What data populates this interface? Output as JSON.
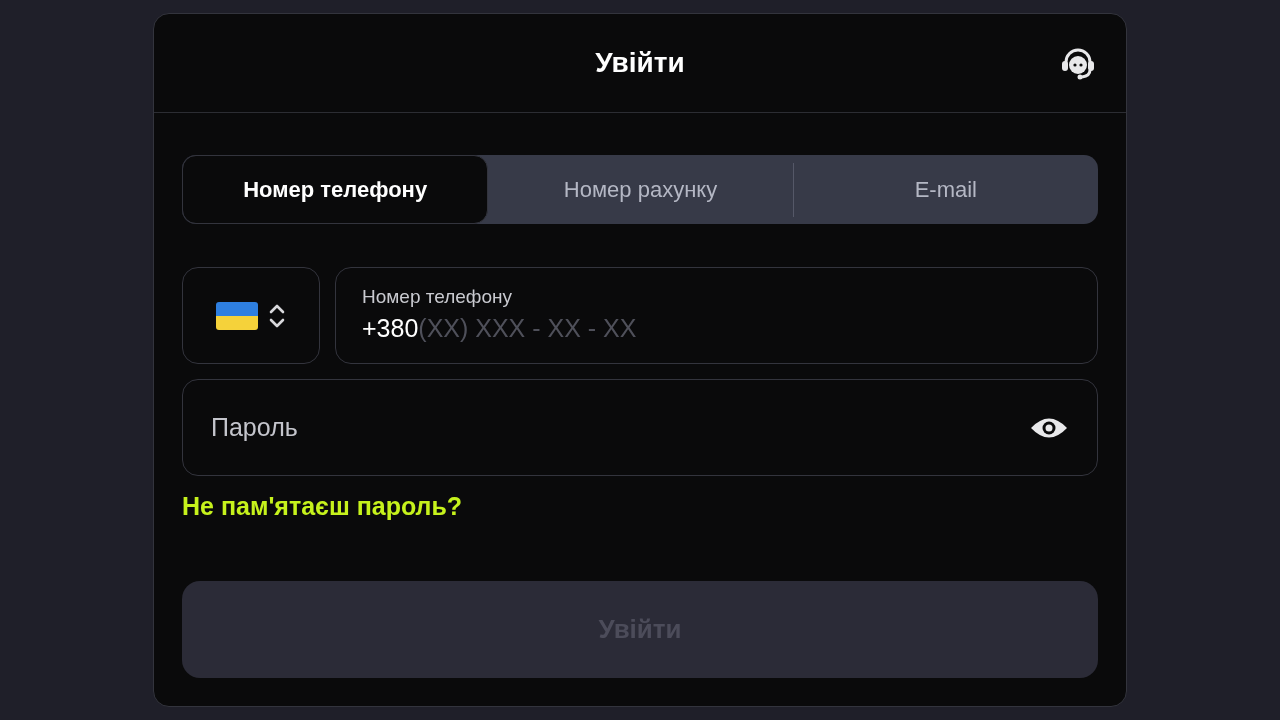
{
  "dialog": {
    "title": "Увійти"
  },
  "tabs": [
    {
      "label": "Номер телефону",
      "selected": true
    },
    {
      "label": "Номер рахунку",
      "selected": false
    },
    {
      "label": "E-mail",
      "selected": false
    }
  ],
  "phone": {
    "label": "Номер телефону",
    "prefix": "+380",
    "placeholder": "(XX) XXX - XX - XX"
  },
  "password": {
    "placeholder": "Пароль"
  },
  "forgot_link": "Не пам'ятаєш пароль?",
  "submit": {
    "label": "Увійти",
    "disabled": true
  }
}
